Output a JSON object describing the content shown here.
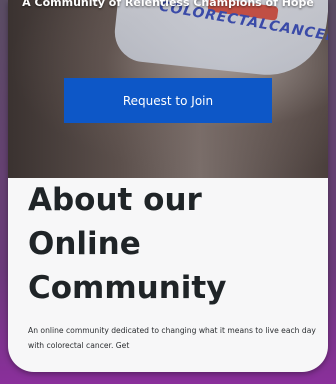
{
  "hero": {
    "tagline": "A Community of Relentless Champions of Hope",
    "shirt_text": "COLORECTALCANCER",
    "join_button": "Request to Join"
  },
  "about": {
    "title": "About our Online Community",
    "description": "An online community dedicated to changing what it means to live each day with colorectal cancer. Get"
  }
}
